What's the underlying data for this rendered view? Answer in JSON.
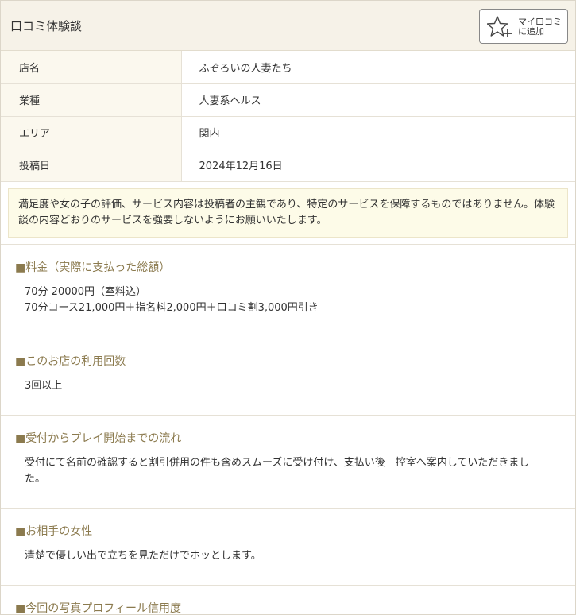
{
  "header": {
    "title": "口コミ体験談",
    "mylist_line1": "マイ口コミ",
    "mylist_line2": "に追加"
  },
  "info": [
    {
      "label": "店名",
      "value": "ふぞろいの人妻たち"
    },
    {
      "label": "業種",
      "value": "人妻系ヘルス"
    },
    {
      "label": "エリア",
      "value": "関内"
    },
    {
      "label": "投稿日",
      "value": "2024年12月16日"
    }
  ],
  "notice": "満足度や女の子の評価、サービス内容は投稿者の主観であり、特定のサービスを保障するものではありません。体験談の内容どおりのサービスを強要しないようにお願いいたします。",
  "sections": {
    "price": {
      "title": "■料金（実際に支払った総額）",
      "line1": "70分 20000円（室料込）",
      "line2": "70分コース21,000円＋指名料2,000円＋口コミ割3,000円引き"
    },
    "visits": {
      "title": "■このお店の利用回数",
      "body": "3回以上"
    },
    "flow": {
      "title": "■受付からプレイ開始までの流れ",
      "body": "受付にて名前の確認すると割引併用の件も含めスムーズに受け付け、支払い後　控室へ案内していただきました。"
    },
    "partner": {
      "title": "■お相手の女性",
      "body": "清楚で優しい出で立ちを見ただけでホッとします。"
    },
    "photo": {
      "title": "■今回の写真プロフィール信用度"
    }
  }
}
